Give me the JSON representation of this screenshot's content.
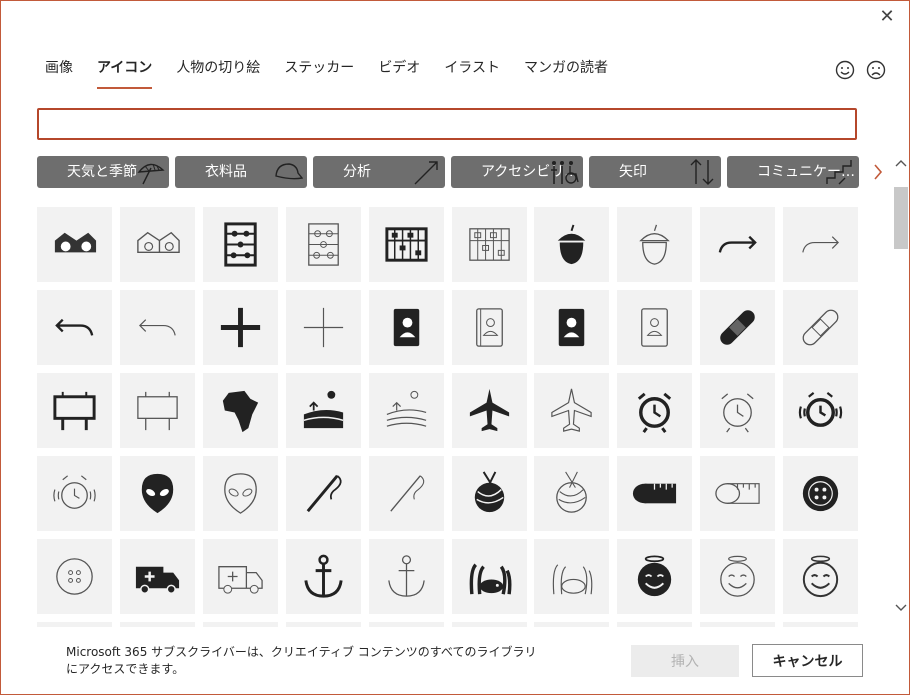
{
  "tabs": [
    {
      "label": "画像",
      "active": false
    },
    {
      "label": "アイコン",
      "active": true
    },
    {
      "label": "人物の切り絵",
      "active": false
    },
    {
      "label": "ステッカー",
      "active": false
    },
    {
      "label": "ビデオ",
      "active": false
    },
    {
      "label": "イラスト",
      "active": false
    },
    {
      "label": "マンガの読者",
      "active": false
    }
  ],
  "search": {
    "value": "",
    "placeholder": ""
  },
  "categories": [
    {
      "label": "天気と季節",
      "icon": "umbrella-icon"
    },
    {
      "label": "衣料品",
      "icon": "cap-icon"
    },
    {
      "label": "分析",
      "icon": "arrow-trend-icon"
    },
    {
      "label": "アクセシビリ…",
      "icon": "accessibility-icon"
    },
    {
      "label": "矢印",
      "icon": "up-down-arrows-icon"
    },
    {
      "label": "コミュニケー…",
      "icon": "stairs-icon"
    }
  ],
  "icons": [
    "3d-glasses-icon",
    "3d-glasses-outline-icon",
    "abacus-icon",
    "abacus-outline-icon",
    "abacus-wide-icon",
    "abacus-wide-outline-icon",
    "acorn-icon",
    "acorn-outline-icon",
    "arrow-curve-right-icon",
    "arrow-curve-right-outline-icon",
    "arrow-curve-left-icon",
    "arrow-curve-left-outline-icon",
    "plus-icon",
    "plus-outline-icon",
    "address-book-icon",
    "address-book-outline-icon",
    "contact-book-icon",
    "contact-book-outline-icon",
    "bandage-icon",
    "bandage-outline-icon",
    "billboard-icon",
    "billboard-outline-icon",
    "africa-icon",
    "farm-field-icon",
    "farm-field-outline-icon",
    "airplane-icon",
    "airplane-outline-icon",
    "alarm-clock-icon",
    "alarm-clock-outline-icon",
    "alarm-ringing-icon",
    "alarm-ringing-outline-icon",
    "alien-icon",
    "alien-outline-icon",
    "needle-thread-icon",
    "needle-thread-outline-icon",
    "yarn-icon",
    "yarn-outline-icon",
    "measuring-tape-icon",
    "measuring-tape-outline-icon",
    "button-icon",
    "button-outline-icon",
    "ambulance-icon",
    "ambulance-outline-icon",
    "anchor-icon",
    "anchor-outline-icon",
    "anemone-fish-icon",
    "anemone-fish-outline-icon",
    "smiling-angel-icon",
    "smiling-angel-outline-icon",
    "smiling-angel-outline-thin-icon",
    "row6-icon-1",
    "row6-icon-2",
    "row6-icon-3",
    "row6-icon-4",
    "row6-icon-5",
    "row6-icon-6",
    "row6-icon-7",
    "row6-icon-8",
    "row6-icon-9",
    "row6-icon-10"
  ],
  "footer": {
    "note": "Microsoft 365 サブスクライバーは、クリエイティブ コンテンツのすべてのライブラリにアクセスできます。",
    "insert_label": "挿入",
    "cancel_label": "キャンセル"
  },
  "colors": {
    "accent": "#c25a3a",
    "category_bg": "#6e6e6e",
    "tile_bg": "#f2f2f2"
  }
}
